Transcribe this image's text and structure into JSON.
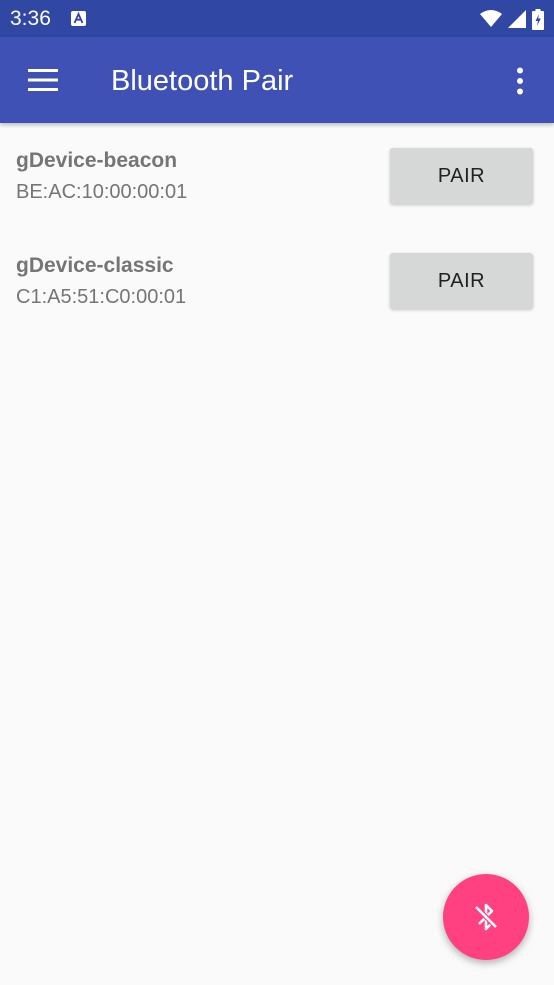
{
  "status_bar": {
    "time": "3:36",
    "icons": [
      "a-notification-icon",
      "wifi-icon",
      "signal-icon",
      "battery-icon"
    ]
  },
  "app_bar": {
    "title": "Bluetooth Pair",
    "menu_icon": "hamburger-menu-icon",
    "overflow_icon": "more-vert-icon"
  },
  "devices": [
    {
      "name": "gDevice-beacon",
      "address": "BE:AC:10:00:00:01",
      "action_label": "PAIR"
    },
    {
      "name": "gDevice-classic",
      "address": "C1:A5:51:C0:00:01",
      "action_label": "PAIR"
    }
  ],
  "fab": {
    "icon": "bluetooth-disabled-icon"
  },
  "colors": {
    "status_bar": "#3047a3",
    "app_bar": "#3f51b5",
    "fab": "#ff4081",
    "button": "#d6d7d7",
    "background": "#fafafa"
  }
}
